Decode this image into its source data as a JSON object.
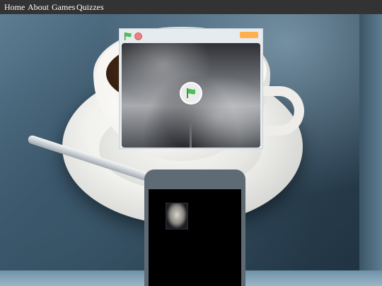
{
  "nav": {
    "links": [
      "Home",
      "About",
      "Games",
      "Quizzes"
    ]
  },
  "player": {
    "flag_icon": "green-flag-icon",
    "stop_icon": "stop-sign-icon",
    "play_icon": "green-flag-play-icon"
  },
  "colors": {
    "nav_bg": "#333333",
    "nav_text": "#ffffff",
    "flag_green": "#4cbf56",
    "stop_red": "#ec7f7f",
    "phone_body": "#5f6b74"
  }
}
